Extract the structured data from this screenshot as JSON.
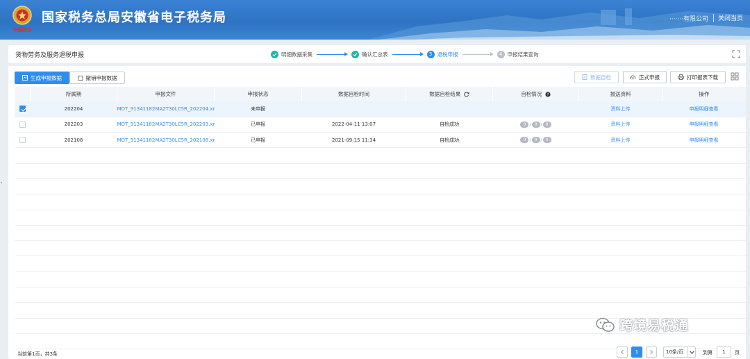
{
  "header": {
    "title": "国家税务总局安徽省电子税务局",
    "user": "·······有限公司",
    "close_label": "关闭当页",
    "emblem_text": "中国税务"
  },
  "page": {
    "title": "货物劳务及服务退税申报",
    "steps": [
      {
        "num": "1",
        "label": "明细数据采集",
        "state": "done"
      },
      {
        "num": "2",
        "label": "确认汇总表",
        "state": "done"
      },
      {
        "num": "3",
        "label": "退税申报",
        "state": "current"
      },
      {
        "num": "4",
        "label": "申报结果查询",
        "state": "todo"
      }
    ]
  },
  "toolbar": {
    "generate_label": "生成申报数据",
    "revoke_label": "撤销申报数据",
    "selfcheck_label": "数据自检",
    "formal_label": "正式申报",
    "print_label": "打印报表下载"
  },
  "table": {
    "headers": [
      "",
      "所属期",
      "申报文件",
      "申报状态",
      "数据自检时间",
      "数据自检结果",
      "自检情况",
      "报送资料",
      "操作"
    ],
    "rows": [
      {
        "checked": true,
        "period": "202204",
        "file": "MDT_91341182MA2T30LC5R_202204.xml",
        "status": "未申报",
        "time": "",
        "result": "",
        "pills": false,
        "upload": "资料上传",
        "action": "申报明细查看"
      },
      {
        "checked": false,
        "period": "202203",
        "file": "MDT_91341182MA2T30LC5R_202203.xml",
        "status": "已申报",
        "time": "2022-04-11 13:07",
        "result": "自检成功",
        "pills": true,
        "upload": "资料上传",
        "action": "申报明细查看"
      },
      {
        "checked": false,
        "period": "202108",
        "file": "MDT_91341182MA2T30LC5R_202108.xml",
        "status": "已申报",
        "time": "2021-09-15 11:34",
        "result": "自检成功",
        "pills": true,
        "upload": "资料上传",
        "action": "申报明细查看"
      }
    ],
    "pill_values": [
      "0",
      "0",
      "0"
    ]
  },
  "footer": {
    "summary": "当前第1页，共3条",
    "page_size": "10条/页",
    "current_page": "1",
    "goto_label": "到第",
    "goto_value": "1",
    "page_suffix": "页"
  },
  "watermark": "跨境易税通",
  "colors": {
    "header_blue": "#2e73c4",
    "accent": "#2f8df0",
    "done": "#26b3a5"
  }
}
